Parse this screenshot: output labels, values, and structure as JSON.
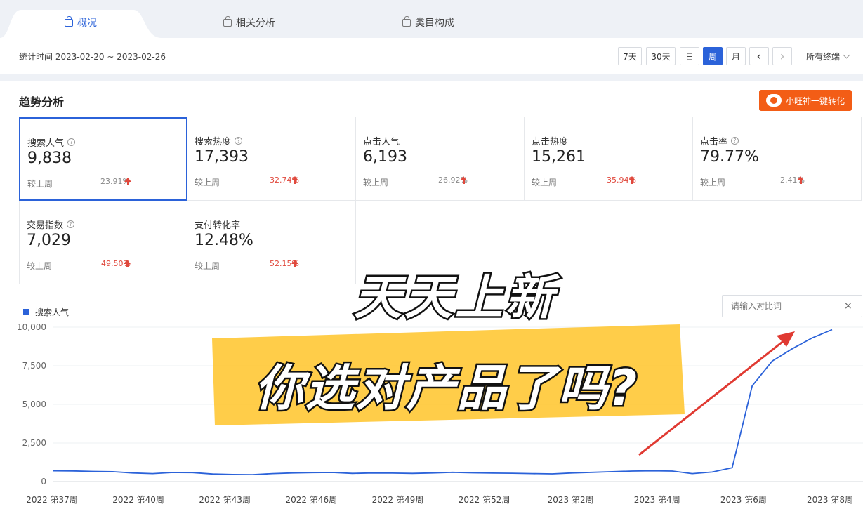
{
  "tabs": [
    {
      "label": "概况",
      "active": true
    },
    {
      "label": "相关分析",
      "active": false
    },
    {
      "label": "类目构成",
      "active": false
    }
  ],
  "date_range": "统计时间 2023-02-20 ~ 2023-02-26",
  "period_buttons": [
    {
      "label": "7天",
      "active": false
    },
    {
      "label": "30天",
      "active": false
    },
    {
      "label": "日",
      "active": false
    },
    {
      "label": "周",
      "active": true
    },
    {
      "label": "月",
      "active": false
    }
  ],
  "nav": {
    "prev": "‹",
    "next": "›"
  },
  "terminal_select": "所有终端",
  "section_title": "趋势分析",
  "convert_button": "小旺神一键转化",
  "metrics": [
    {
      "label": "搜索人气",
      "help": true,
      "value": "9,838",
      "compare_label": "较上周",
      "change": "23.91%",
      "change_color": "gray",
      "selected": true
    },
    {
      "label": "搜索热度",
      "help": true,
      "value": "17,393",
      "compare_label": "较上周",
      "change": "32.74%",
      "change_color": "red",
      "selected": false
    },
    {
      "label": "点击人气",
      "help": false,
      "value": "6,193",
      "compare_label": "较上周",
      "change": "26.92%",
      "change_color": "gray",
      "selected": false
    },
    {
      "label": "点击热度",
      "help": false,
      "value": "15,261",
      "compare_label": "较上周",
      "change": "35.94%",
      "change_color": "red",
      "selected": false
    },
    {
      "label": "点击率",
      "help": true,
      "value": "79.77%",
      "compare_label": "较上周",
      "change": "2.41%",
      "change_color": "gray",
      "selected": false
    },
    {
      "label": "交易指数",
      "help": true,
      "value": "7,029",
      "compare_label": "较上周",
      "change": "49.50%",
      "change_color": "red",
      "selected": false
    },
    {
      "label": "支付转化率",
      "help": false,
      "value": "12.48%",
      "compare_label": "较上周",
      "change": "52.15%",
      "change_color": "red",
      "selected": false
    }
  ],
  "compare_input": {
    "placeholder": "请输入对比词",
    "close": "×"
  },
  "overlay": {
    "line1": "天天上新",
    "line2": "你选对产品了吗?"
  },
  "chart_data": {
    "type": "line",
    "series": [
      {
        "name": "搜索人气",
        "color": "#2b62d9",
        "values": [
          700,
          690,
          660,
          640,
          560,
          520,
          590,
          580,
          490,
          460,
          450,
          520,
          560,
          580,
          590,
          530,
          560,
          550,
          530,
          560,
          600,
          570,
          550,
          540,
          520,
          500,
          560,
          600,
          640,
          680,
          700,
          680,
          520,
          620,
          900,
          6200,
          7800,
          8600,
          9300,
          9838
        ]
      }
    ],
    "x_ticks": [
      "2022 第37周",
      "2022 第40周",
      "2022 第43周",
      "2022 第46周",
      "2022 第49周",
      "2022 第52周",
      "2023 第2周",
      "2023 第4周",
      "2023 第6周",
      "2023 第8周"
    ],
    "y_ticks": [
      "0",
      "2,500",
      "5,000",
      "7,500",
      "10,000"
    ],
    "ylim": [
      0,
      10000
    ],
    "grid": true
  }
}
